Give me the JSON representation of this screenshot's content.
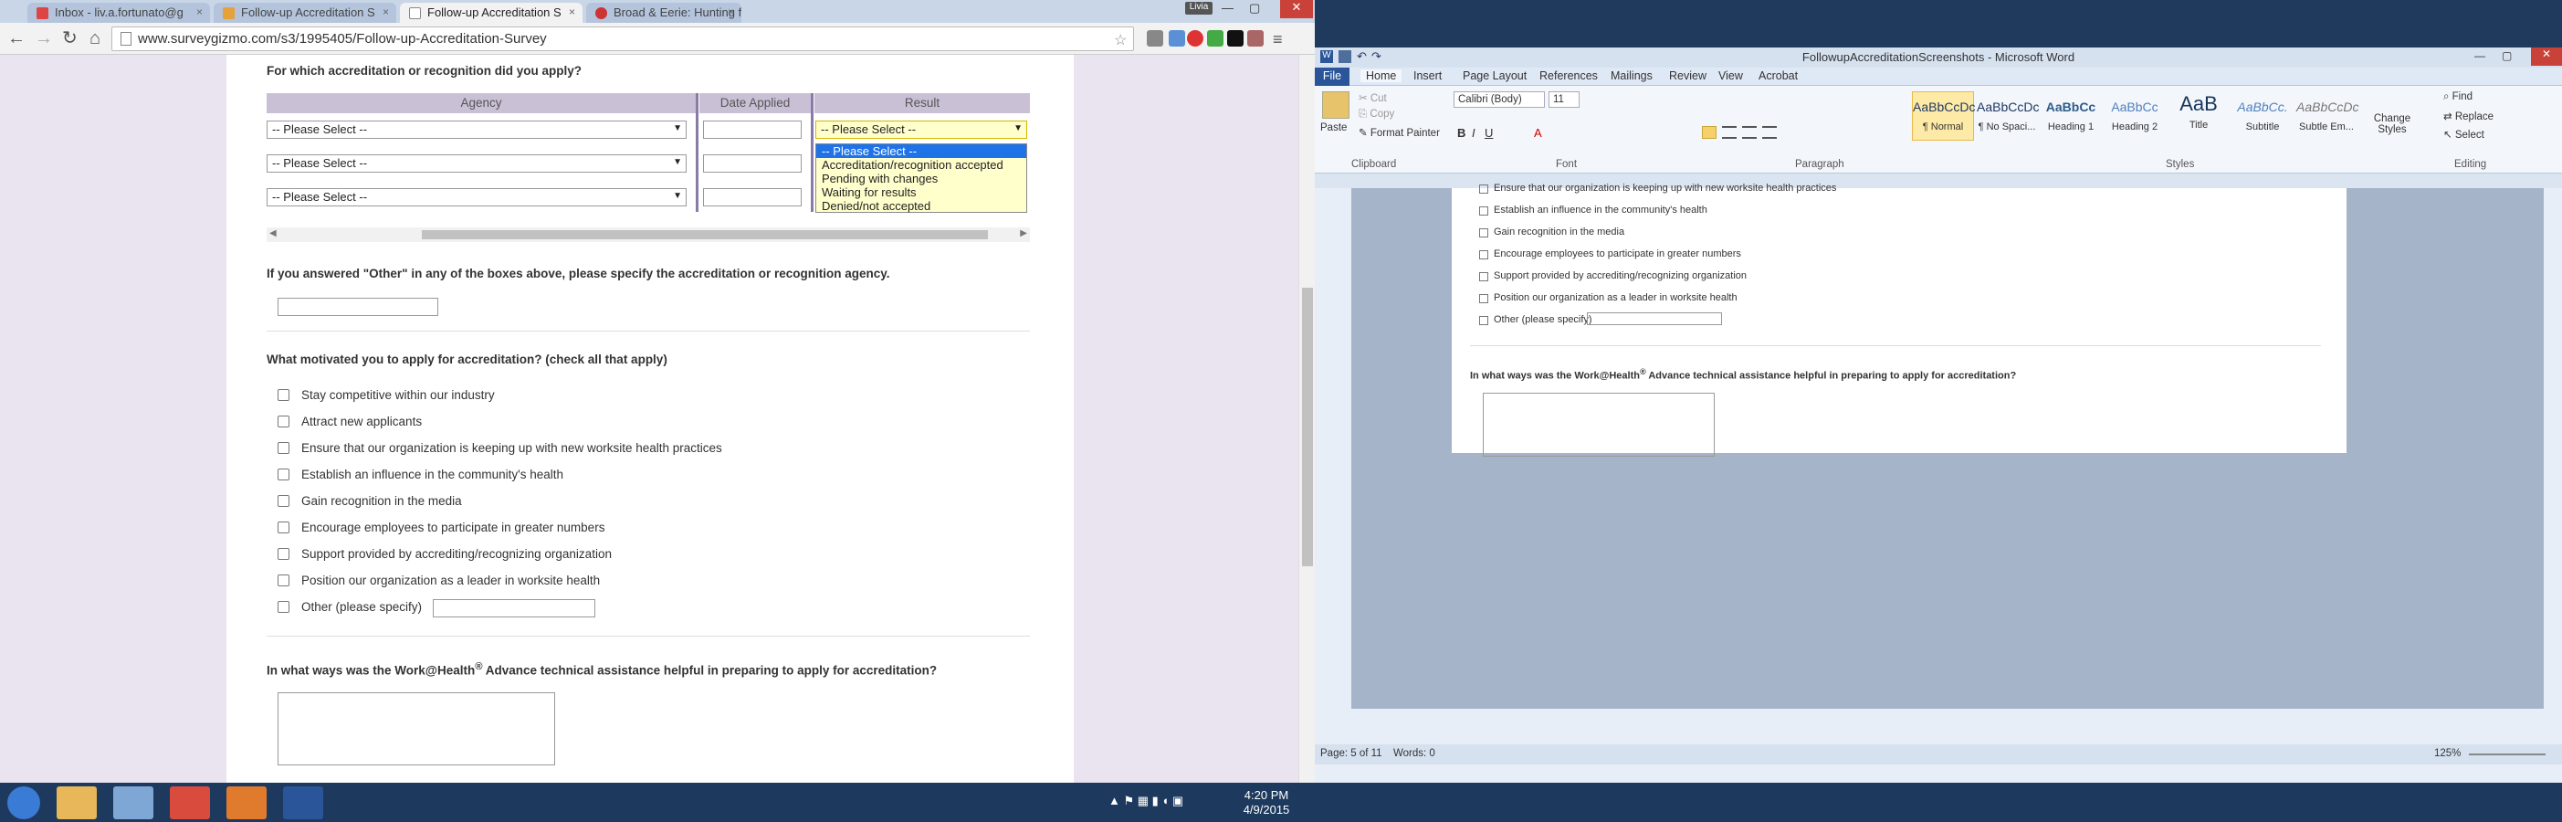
{
  "browser": {
    "tabs": [
      {
        "label": "Inbox - liv.a.fortunato@g",
        "active": false
      },
      {
        "label": "Follow-up Accreditation S",
        "active": false
      },
      {
        "label": "Follow-up Accreditation S",
        "active": true
      },
      {
        "label": "Broad & Eerie: Hunting fo",
        "active": false
      }
    ],
    "profile_name": "Livia",
    "url": "www.surveygizmo.com/s3/1995405/Follow-up-Accreditation-Survey"
  },
  "survey": {
    "q1": "For which accreditation or recognition did you apply?",
    "headers": {
      "agency": "Agency",
      "date": "Date Applied",
      "result": "Result"
    },
    "agency_placeholder": "-- Please Select --",
    "result_selected": "-- Please Select --",
    "result_options": [
      "-- Please Select --",
      "Accreditation/recognition accepted",
      "Pending with changes",
      "Waiting for results",
      "Denied/not accepted"
    ],
    "q2": "If you answered \"Other\" in any of the boxes above, please specify the accreditation or recognition agency.",
    "q3": "What motivated you to apply for accreditation? (check all that apply)",
    "checkboxes": [
      "Stay competitive within our industry",
      "Attract new applicants",
      "Ensure that our organization is keeping up with new worksite health practices",
      "Establish an influence in the community's health",
      "Gain recognition in the media",
      "Encourage employees to participate in greater numbers",
      "Support provided by accrediting/recognizing organization",
      "Position our organization as a leader in worksite health",
      "Other (please specify)"
    ],
    "q4_prefix": "In what ways was the Work@Health",
    "q4_sup": "®",
    "q4_suffix": " Advance technical assistance helpful in preparing to apply for accreditation?"
  },
  "word": {
    "title": "FollowupAccreditationScreenshots - Microsoft Word",
    "tabs": [
      "File",
      "Home",
      "Insert",
      "Page Layout",
      "References",
      "Mailings",
      "Review",
      "View",
      "Acrobat"
    ],
    "clipboard": {
      "paste": "Paste",
      "cut": "Cut",
      "copy": "Copy",
      "format_painter": "Format Painter",
      "group": "Clipboard"
    },
    "font": {
      "name": "Calibri (Body)",
      "size": "11",
      "group": "Font"
    },
    "paragraph_group": "Paragraph",
    "styles": [
      {
        "preview": "AaBbCcDc",
        "name": "¶ Normal"
      },
      {
        "preview": "AaBbCcDc",
        "name": "¶ No Spaci..."
      },
      {
        "preview": "AaBbCc",
        "name": "Heading 1"
      },
      {
        "preview": "AaBbCc",
        "name": "Heading 2"
      },
      {
        "preview": "AaB",
        "name": "Title"
      },
      {
        "preview": "AaBbCc.",
        "name": "Subtitle"
      },
      {
        "preview": "AaBbCcDc",
        "name": "Subtle Em..."
      }
    ],
    "styles_group": "Styles",
    "change_styles": "Change Styles",
    "editing": {
      "find": "Find",
      "replace": "Replace",
      "select": "Select",
      "group": "Editing"
    },
    "doc_items": [
      "Ensure that our organization is keeping up with new worksite health practices",
      "Establish an influence in the community's health",
      "Gain recognition in the media",
      "Encourage employees to participate in greater numbers",
      "Support provided by accrediting/recognizing organization",
      "Position our organization as a leader in worksite health",
      "Other (please specify)"
    ],
    "doc_question_prefix": "In what ways was the Work@Health",
    "doc_question_sup": "®",
    "doc_question_suffix": " Advance technical assistance helpful in preparing to apply for accreditation?",
    "status_page": "Page: 5 of 11",
    "status_words": "Words: 0",
    "zoom": "125%"
  },
  "taskbar": {
    "time": "4:20 PM",
    "date": "4/9/2015"
  }
}
